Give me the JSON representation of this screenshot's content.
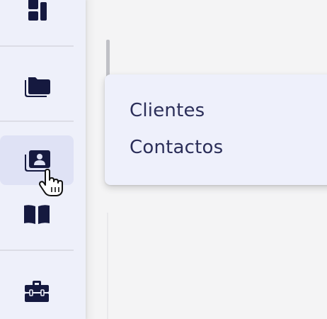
{
  "sidebar": {
    "items": [
      {
        "name": "dashboard",
        "icon": "dashboard-icon"
      },
      {
        "name": "folder",
        "icon": "folder-icon"
      },
      {
        "name": "contacts",
        "icon": "contact-card-icon",
        "active": true
      },
      {
        "name": "book",
        "icon": "book-open-icon"
      },
      {
        "name": "toolbox",
        "icon": "toolbox-icon"
      }
    ]
  },
  "popup_menu": {
    "items": [
      {
        "label": "Clientes"
      },
      {
        "label": "Contactos"
      }
    ]
  },
  "colors": {
    "sidebar_bg": "#eef0fa",
    "active_item_bg": "#dfe2f5",
    "icon_color": "#15193f",
    "menu_text": "#2b2e59",
    "page_bg": "#f4f4f5"
  },
  "cursor": "hand-pointer-icon"
}
